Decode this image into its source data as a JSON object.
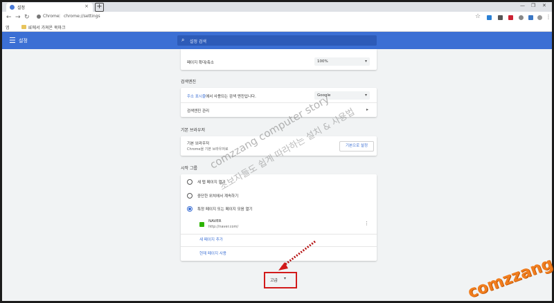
{
  "tab": {
    "title": "설정",
    "close": "×",
    "new": "+"
  },
  "window_controls": {
    "min": "—",
    "max": "❐",
    "close": "✕"
  },
  "toolbar": {
    "back": "←",
    "forward": "→",
    "reload": "↻",
    "host": "Chrome",
    "separator": "|",
    "path": "chrome://settings",
    "star": "☆",
    "menu": "⋮"
  },
  "bookmarks": {
    "apps_label": "앱",
    "folder_label": "IE에서 가져온 북마크"
  },
  "header": {
    "title": "설정",
    "menu_icon": "☰",
    "search_icon": "🔍",
    "search_placeholder": "설정 검색"
  },
  "page_zoom": {
    "label": "페이지 확대/축소",
    "value": "100%"
  },
  "search_engine": {
    "section": "검색엔진",
    "label_link": "주소 표시줄",
    "label_rest": "에서 사용되는 검색 엔진입니다.",
    "value": "Google",
    "manage": "검색엔진 관리",
    "manage_arrow": "▸"
  },
  "default_browser": {
    "section": "기본 브라우저",
    "label": "기본 브라우저",
    "sub": "Chrome을 기본 브라우저로",
    "button": "기본으로 설정"
  },
  "startup": {
    "section": "시작 그룹",
    "options": [
      {
        "label": "새 탭 페이지 열기",
        "selected": false
      },
      {
        "label": "중단한 위치에서 계속하기",
        "selected": false
      },
      {
        "label": "특정 페이지 또는 페이지 모음 열기",
        "selected": true
      }
    ],
    "page_title": "NAVER",
    "page_url": "http://naver.com/",
    "page_menu": "⋮",
    "add_page": "새 페이지 추가",
    "use_current": "현재 페이지 사용"
  },
  "advanced": {
    "label": "고급",
    "chevron": "▾"
  },
  "watermark": {
    "line1": "comzzang computer story",
    "line2": "초보자들도 쉽게 따라하는 설치 & 사용법",
    "brand": "comzzang"
  },
  "colors": {
    "accent": "#3b6fd4",
    "highlight": "#d21a1a",
    "brand": "#f07d1e"
  }
}
